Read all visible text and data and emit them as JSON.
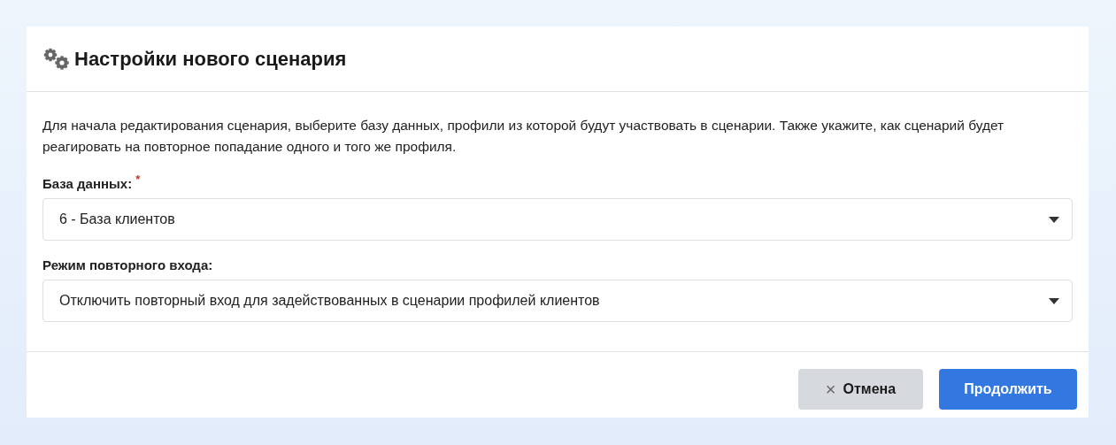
{
  "dialog": {
    "title": "Настройки нового сценария",
    "description": "Для начала редактирования сценария, выберите базу данных, профили из которой будут участвовать в сценарии. Также укажите, как сценарий будет реагировать на повторное попадание одного и того же профиля.",
    "fields": [
      {
        "label": "База данных:",
        "required_mark": "*",
        "value": "6 - База клиентов"
      },
      {
        "label": "Режим повторного входа:",
        "value": "Отключить повторный вход для задействованных в сценарии профилей клиентов"
      }
    ],
    "buttons": [
      {
        "kind": "cancel",
        "icon": "×",
        "label": "Отмена"
      },
      {
        "kind": "primary",
        "label": "Продолжить"
      }
    ]
  }
}
